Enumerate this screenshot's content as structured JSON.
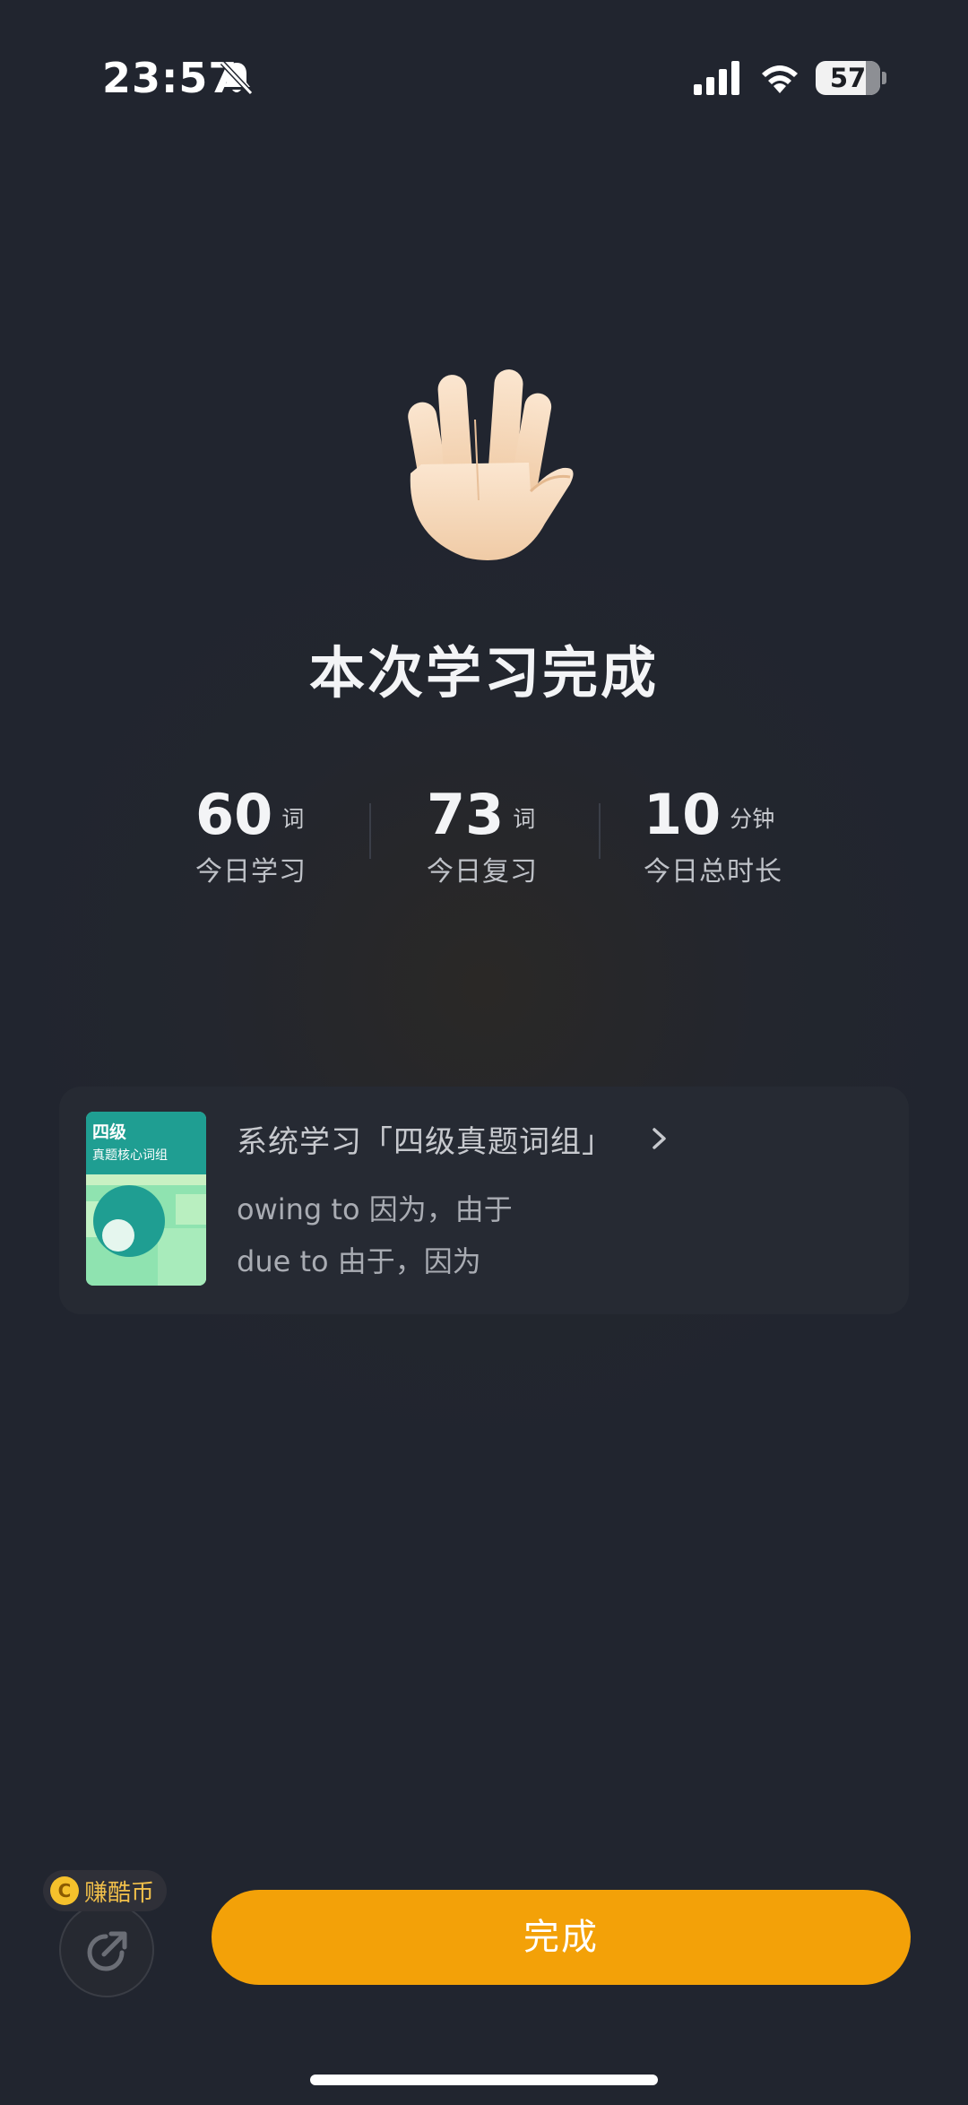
{
  "status_bar": {
    "time": "23:57",
    "battery": "57",
    "icons": [
      "bell-off-icon",
      "signal-icon",
      "wifi-icon",
      "battery-icon"
    ]
  },
  "hero": {
    "emoji": "vulcan-salute-hand",
    "title": "本次学习完成"
  },
  "stats": [
    {
      "value": "60",
      "unit": "词",
      "label": "今日学习"
    },
    {
      "value": "73",
      "unit": "词",
      "label": "今日复习"
    },
    {
      "value": "10",
      "unit": "分钟",
      "label": "今日总时长"
    }
  ],
  "book_card": {
    "cover_level": "四级",
    "cover_subtitle": "真题核心词组",
    "title": "系统学习「四级真题词组」",
    "line1": "owing to 因为，由于",
    "line2": "due to 由于，因为"
  },
  "bottom": {
    "coin_badge": "赚酷币",
    "coin_symbol": "C",
    "done_label": "完成"
  },
  "colors": {
    "background": "#21252f",
    "accent": "#f3a108",
    "coin": "#f5c12c"
  }
}
